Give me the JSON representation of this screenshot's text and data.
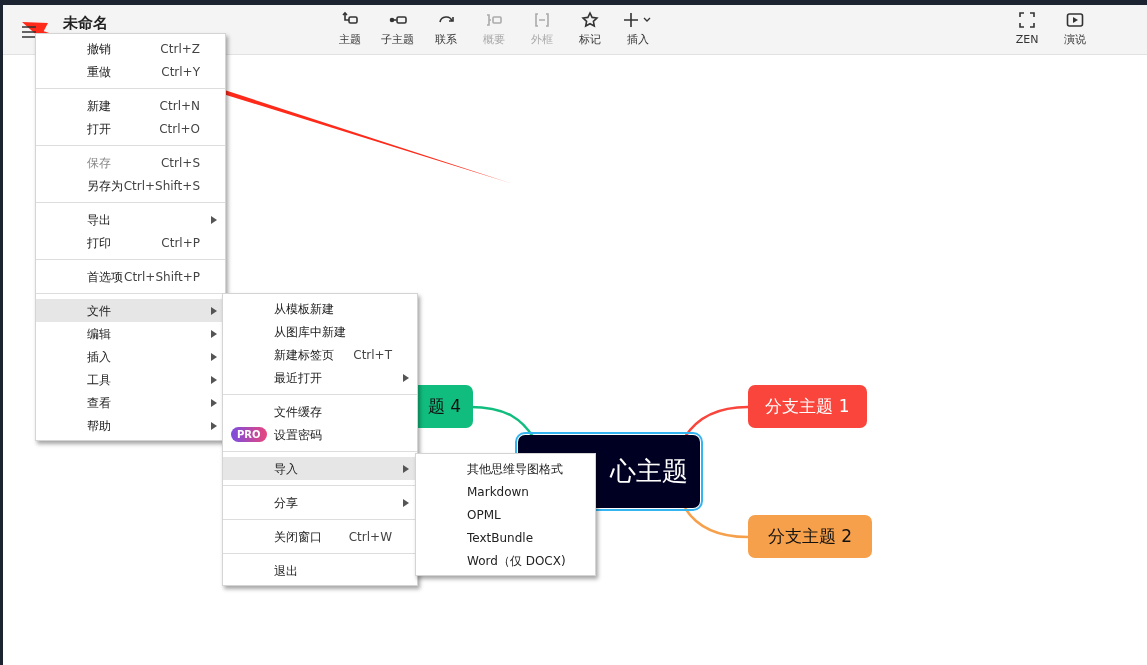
{
  "header": {
    "title": "未命名"
  },
  "toolbar": [
    {
      "label": "主题",
      "disabled": false
    },
    {
      "label": "子主题",
      "disabled": false
    },
    {
      "label": "联系",
      "disabled": false
    },
    {
      "label": "概要",
      "disabled": true
    },
    {
      "label": "外框",
      "disabled": true
    },
    {
      "label": "标记",
      "disabled": false
    },
    {
      "label": "插入",
      "disabled": false
    }
  ],
  "toolbar_right": [
    {
      "label": "ZEN"
    },
    {
      "label": "演说"
    }
  ],
  "mind_map": {
    "central": {
      "text": "心主题"
    },
    "branches": [
      {
        "text": "题 4",
        "color": "#10bd7e"
      },
      {
        "text": "分支主题 1",
        "color": "#f9453c"
      },
      {
        "text": "分支主题 2",
        "color": "#f6a04c"
      }
    ]
  },
  "main_menu": {
    "groups": [
      [
        {
          "label": "撤销",
          "shortcut": "Ctrl+Z",
          "submenu": false,
          "disabled": false,
          "selected": false
        },
        {
          "label": "重做",
          "shortcut": "Ctrl+Y",
          "submenu": false,
          "disabled": false,
          "selected": false
        }
      ],
      [
        {
          "label": "新建",
          "shortcut": "Ctrl+N",
          "submenu": false,
          "disabled": false,
          "selected": false
        },
        {
          "label": "打开",
          "shortcut": "Ctrl+O",
          "submenu": false,
          "disabled": false,
          "selected": false
        }
      ],
      [
        {
          "label": "保存",
          "shortcut": "Ctrl+S",
          "submenu": false,
          "disabled": true,
          "selected": false
        },
        {
          "label": "另存为",
          "shortcut": "Ctrl+Shift+S",
          "submenu": false,
          "disabled": false,
          "selected": false
        }
      ],
      [
        {
          "label": "导出",
          "submenu": true,
          "disabled": false,
          "selected": false
        },
        {
          "label": "打印",
          "shortcut": "Ctrl+P",
          "submenu": false,
          "disabled": false,
          "selected": false
        }
      ],
      [
        {
          "label": "首选项",
          "shortcut": "Ctrl+Shift+P",
          "submenu": false,
          "disabled": false,
          "selected": false
        }
      ],
      [
        {
          "label": "文件",
          "submenu": true,
          "disabled": false,
          "selected": true
        },
        {
          "label": "编辑",
          "submenu": true,
          "disabled": false,
          "selected": false
        },
        {
          "label": "插入",
          "submenu": true,
          "disabled": false,
          "selected": false
        },
        {
          "label": "工具",
          "submenu": true,
          "disabled": false,
          "selected": false
        },
        {
          "label": "查看",
          "submenu": true,
          "disabled": false,
          "selected": false
        },
        {
          "label": "帮助",
          "submenu": true,
          "disabled": false,
          "selected": false
        }
      ]
    ]
  },
  "file_menu": {
    "groups": [
      [
        {
          "label": "从模板新建",
          "submenu": false,
          "disabled": false,
          "selected": false
        },
        {
          "label": "从图库中新建",
          "submenu": false,
          "disabled": false,
          "selected": false
        },
        {
          "label": "新建标签页",
          "shortcut": "Ctrl+T",
          "submenu": false,
          "disabled": false,
          "selected": false
        },
        {
          "label": "最近打开",
          "submenu": true,
          "disabled": false,
          "selected": false
        }
      ],
      [
        {
          "label": "文件缓存",
          "submenu": false,
          "disabled": false,
          "selected": false
        },
        {
          "label": "设置密码",
          "badge": "PRO",
          "submenu": false,
          "disabled": false,
          "selected": false
        }
      ],
      [
        {
          "label": "导入",
          "submenu": true,
          "disabled": false,
          "selected": true
        }
      ],
      [
        {
          "label": "分享",
          "submenu": true,
          "disabled": false,
          "selected": false
        }
      ],
      [
        {
          "label": "关闭窗口",
          "shortcut": "Ctrl+W",
          "submenu": false,
          "disabled": false,
          "selected": false
        }
      ],
      [
        {
          "label": "退出",
          "submenu": false,
          "disabled": false,
          "selected": false
        }
      ]
    ]
  },
  "import_menu": {
    "groups": [
      [
        {
          "label": "其他思维导图格式",
          "submenu": false,
          "disabled": false,
          "selected": false
        },
        {
          "label": "Markdown",
          "submenu": false,
          "disabled": false,
          "selected": false
        },
        {
          "label": "OPML",
          "submenu": false,
          "disabled": false,
          "selected": false
        },
        {
          "label": "TextBundle",
          "submenu": false,
          "disabled": false,
          "selected": false
        },
        {
          "label": "Word（仅 DOCX)",
          "submenu": false,
          "disabled": false,
          "selected": false
        }
      ]
    ]
  }
}
